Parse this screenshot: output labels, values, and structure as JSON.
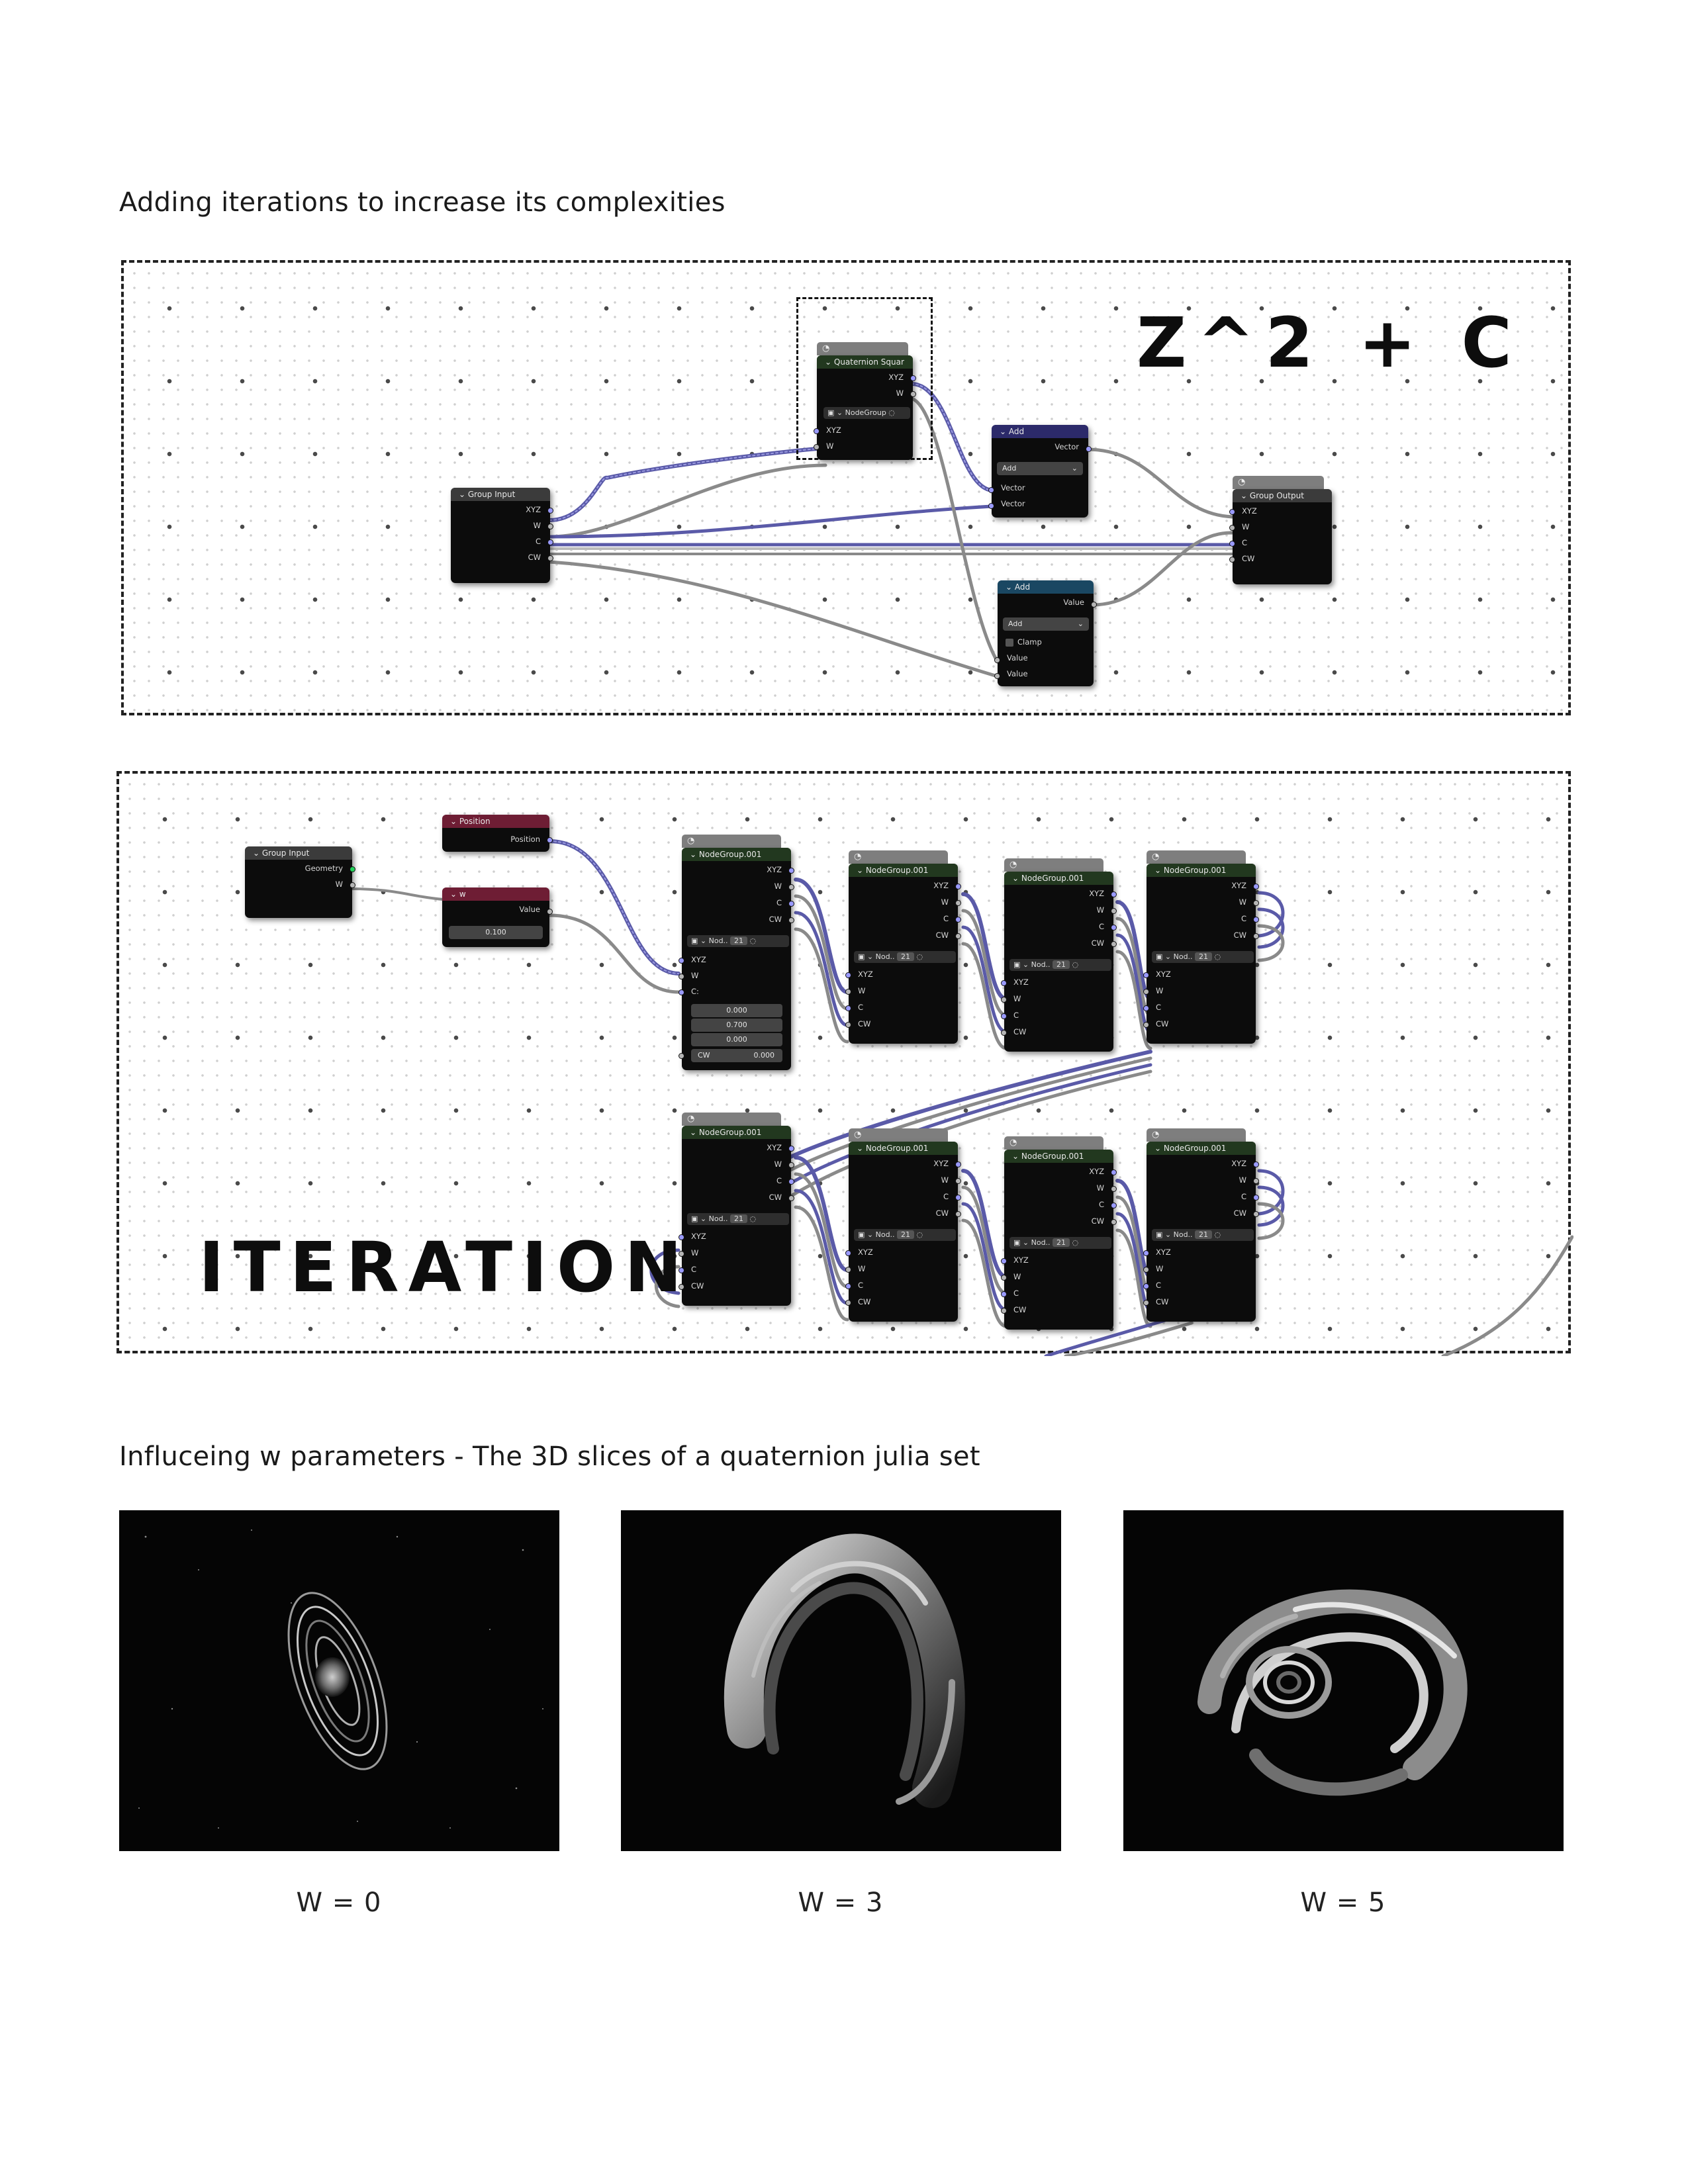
{
  "section1": {
    "heading": "Adding iterations to increase its complexities"
  },
  "panel1": {
    "formula": "Z^2 + C",
    "group_input": {
      "title": "Group Input",
      "outputs": [
        "XYZ",
        "W",
        "C",
        "CW"
      ]
    },
    "quaternion_node": {
      "title": "Quaternion Squar",
      "outputs": [
        "XYZ",
        "W"
      ],
      "group_select": "NodeGroup",
      "inputs": [
        "XYZ",
        "W"
      ]
    },
    "add_vector": {
      "title": "Add",
      "output": "Vector",
      "mode": "Add",
      "inputs": [
        "Vector",
        "Vector"
      ]
    },
    "add_value": {
      "title": "Add",
      "output": "Value",
      "mode": "Add",
      "clamp_label": "Clamp",
      "inputs": [
        "Value",
        "Value"
      ]
    },
    "group_output": {
      "title": "Group Output",
      "inputs": [
        "XYZ",
        "W",
        "C",
        "CW"
      ]
    }
  },
  "panel2": {
    "title_label": "ITERATION",
    "group_input": {
      "title": "Group Input",
      "outputs": [
        "Geometry",
        "W"
      ]
    },
    "position_node": {
      "title": "Position",
      "output": "Position"
    },
    "w_node": {
      "title": "w",
      "output": "Value",
      "value": "0.100"
    },
    "first_group": {
      "title": "NodeGroup.001",
      "outputs": [
        "XYZ",
        "W",
        "C",
        "CW"
      ],
      "select_label": "Nod..",
      "users": "21",
      "inputs": [
        "XYZ",
        "W",
        "C:"
      ],
      "c_values": [
        "0.000",
        "0.700",
        "0.000"
      ],
      "cw_label": "CW",
      "cw_value": "0.000"
    },
    "group_node": {
      "title": "NodeGroup.001",
      "outputs": [
        "XYZ",
        "W",
        "C",
        "CW"
      ],
      "select_label": "Nod..",
      "users": "21",
      "inputs": [
        "XYZ",
        "W",
        "C",
        "CW"
      ]
    }
  },
  "section2": {
    "heading": "Influceing w parameters - The 3D slices of a quaternion julia set"
  },
  "renders": [
    {
      "label": "W  =  0"
    },
    {
      "label": "W  =  3"
    },
    {
      "label": "W  =  5"
    }
  ]
}
